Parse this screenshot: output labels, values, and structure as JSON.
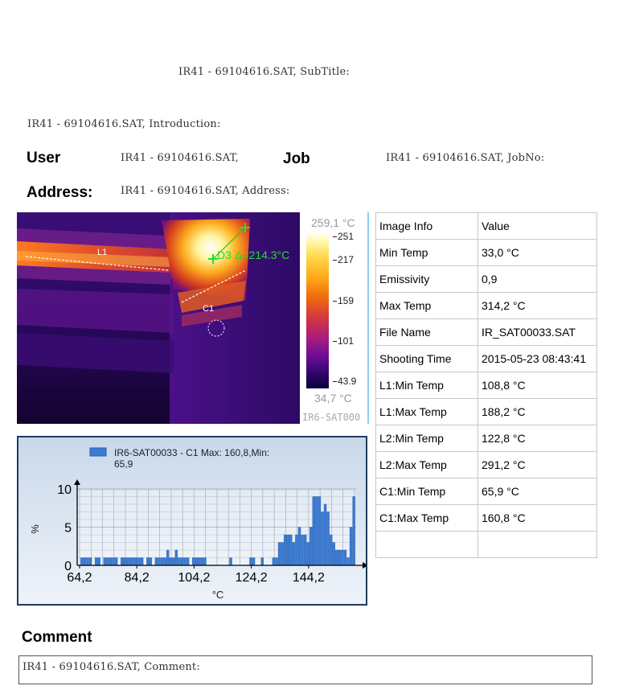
{
  "report": {
    "subtitle": "IR41 - 69104616.SAT, SubTitle:",
    "introduction": "IR41 - 69104616.SAT, Introduction:",
    "user_label": "User",
    "user_value": "IR41 - 69104616.SAT,",
    "job_label": "Job",
    "job_value": "IR41 - 69104616.SAT, JobNo:",
    "address_label": "Address:",
    "address_value": "IR41 - 69104616.SAT, Address:",
    "comment_label": "Comment",
    "comment_value": "IR41 - 69104616.SAT, Comment:"
  },
  "thermal": {
    "l1_label": "L1",
    "c1_label": "C1",
    "d3_label": "D3",
    "delta_label": "Δ=214.3°C",
    "scale_max": "259,1 °C",
    "scale_min": "34,7 °C",
    "ticks": [
      "251",
      "217",
      "159",
      "101",
      "43.9"
    ],
    "file_caption": "IR6-SAT000"
  },
  "info_table": {
    "header": [
      "Image Info",
      "Value"
    ],
    "rows": [
      [
        "Min Temp",
        "33,0 °C"
      ],
      [
        "Emissivity",
        "0,9"
      ],
      [
        "Max Temp",
        "314,2 °C"
      ],
      [
        "File Name",
        "IR_SAT00033.SAT"
      ],
      [
        "Shooting Time",
        "2015-05-23 08:43:41"
      ],
      [
        "L1:Min Temp",
        "108,8 °C"
      ],
      [
        "L1:Max Temp",
        "188,2 °C"
      ],
      [
        "L2:Min Temp",
        "122,8 °C"
      ],
      [
        "L2:Max Temp",
        "291,2 °C"
      ],
      [
        "C1:Min Temp",
        "65,9 °C"
      ],
      [
        "C1:Max Temp",
        "160,8 °C"
      ],
      [
        "",
        ""
      ]
    ]
  },
  "chart_data": {
    "type": "bar",
    "legend_line1": "IR6-SAT00033 - C1 Max: 160,8,Min:",
    "legend_line2": "65,9",
    "xlabel": "°C",
    "ylabel": "%",
    "xlim": [
      64.2,
      160.8
    ],
    "ylim": [
      0,
      10
    ],
    "xticks": [
      "64,2",
      "84,2",
      "104,2",
      "124,2",
      "144,2"
    ],
    "yticks": [
      "0",
      "5",
      "10"
    ],
    "bar_color": "#3a7bd5",
    "x": [
      65,
      66,
      67,
      68,
      70,
      71,
      73,
      74,
      75,
      76,
      77,
      79,
      80,
      81,
      82,
      83,
      84,
      85,
      86,
      88,
      89,
      91,
      92,
      93,
      94,
      95,
      96,
      97,
      98,
      99,
      100,
      101,
      102,
      104,
      105,
      106,
      107,
      108,
      117,
      124,
      125,
      128,
      132,
      133,
      134,
      135,
      136,
      137,
      138,
      139,
      140,
      141,
      142,
      143,
      144,
      145,
      146,
      147,
      148,
      149,
      150,
      151,
      152,
      153,
      154,
      155,
      156,
      157,
      158,
      159,
      160
    ],
    "values": [
      1,
      1,
      1,
      1,
      1,
      1,
      1,
      1,
      1,
      1,
      1,
      1,
      1,
      1,
      1,
      1,
      1,
      1,
      1,
      1,
      1,
      1,
      1,
      1,
      1,
      2,
      1,
      1,
      2,
      1,
      1,
      1,
      1,
      1,
      1,
      1,
      1,
      1,
      1,
      1,
      1,
      1,
      1,
      1,
      3,
      3,
      4,
      4,
      4,
      3,
      4,
      5,
      4,
      4,
      3,
      5,
      9,
      9,
      9,
      7,
      8,
      7,
      4,
      3,
      2,
      2,
      2,
      2,
      1,
      5,
      9
    ]
  }
}
